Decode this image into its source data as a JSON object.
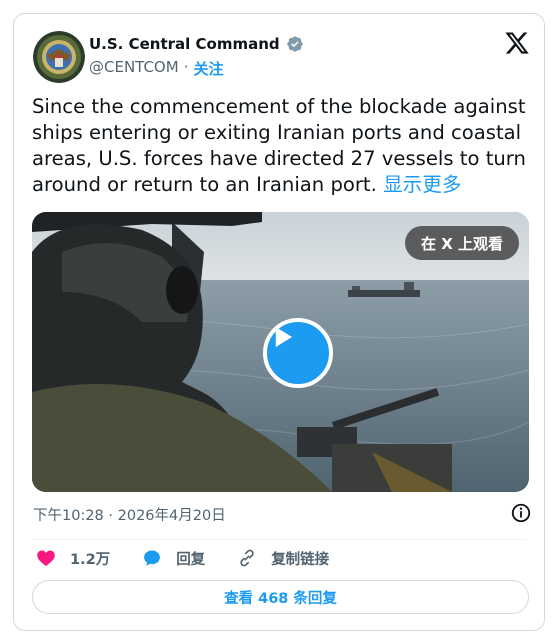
{
  "author": {
    "name": "U.S. Central Command",
    "handle": "@CENTCOM",
    "separator": "·",
    "follow_label": "关注",
    "verified": true,
    "verified_color": "#829aab"
  },
  "tweet": {
    "text": "Since the commencement of the blockade against ships entering or exiting Iranian ports and coastal areas, U.S. forces have directed 27 vessels to turn around or return to an Iranian port.",
    "show_more_label": "显示更多"
  },
  "media": {
    "view_on_x_label": "在 X 上观看",
    "play_icon": "play-icon"
  },
  "meta": {
    "time": "下午10:28",
    "separator": "·",
    "date": "2026年4月20日"
  },
  "actions": {
    "like_count": "1.2万",
    "reply_label": "回复",
    "copy_link_label": "复制链接"
  },
  "footer": {
    "view_replies_label": "查看 468 条回复"
  },
  "colors": {
    "accent": "#1d9bf0",
    "like": "#f91880",
    "text_secondary": "#536471",
    "border": "#cfd9de"
  }
}
